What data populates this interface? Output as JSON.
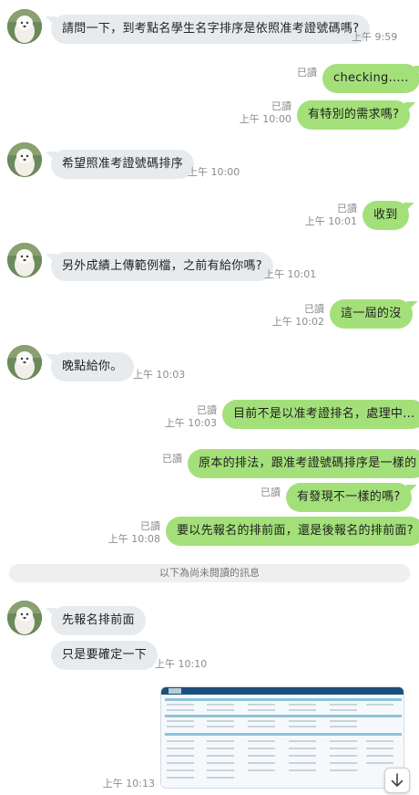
{
  "messages": [
    {
      "text": "請問一下，到考點名學生名字排序是依照准考證號碼嗎?",
      "time": "上午 9:59"
    },
    {
      "text": "checking.....",
      "read": "已讀"
    },
    {
      "text": "有特別的需求嗎?",
      "read": "已讀",
      "time": "上午 10:00"
    },
    {
      "text": "希望照准考證號碼排序",
      "time": "上午 10:00"
    },
    {
      "text": "收到",
      "read": "已讀",
      "time": "上午 10:01"
    },
    {
      "text": "另外成績上傳範例檔，之前有給你嗎?",
      "time": "上午 10:01"
    },
    {
      "text": "這一屆的沒",
      "read": "已讀",
      "time": "上午 10:02"
    },
    {
      "text": "晚點給你。",
      "time": "上午 10:03"
    },
    {
      "text": "目前不是以准考證排名，處理中...",
      "read": "已讀",
      "time": "上午 10:03"
    },
    {
      "text": "原本的排法，跟准考證號碼排序是一樣的",
      "read": "已讀"
    },
    {
      "text": "有發現不一樣的嗎?",
      "read": "已讀"
    },
    {
      "text": "要以先報名的排前面，還是後報名的排前面?",
      "read": "已讀",
      "time": "上午 10:08"
    },
    {
      "text": "先報名排前面"
    },
    {
      "text": "只是要確定一下",
      "time": "上午 10:10"
    }
  ],
  "unread_divider": "以下為尚未閱讀的訊息",
  "image_message": {
    "time": "上午 10:13"
  },
  "colors": {
    "outgoing_bubble": "#a4e07a",
    "incoming_bubble": "#e8ebee",
    "meta_text": "#8c8c8c"
  },
  "icons": {
    "avatar": "dog-photo-avatar",
    "scroll": "arrow-down-icon"
  }
}
